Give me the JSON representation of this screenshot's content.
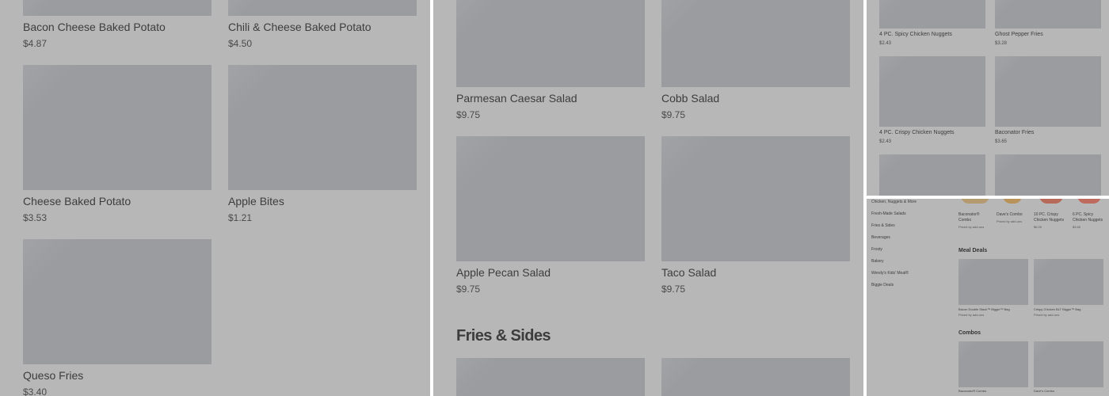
{
  "panel1": {
    "items": [
      {
        "name": "Bacon Cheese Baked Potato",
        "price": "$4.87"
      },
      {
        "name": "Chili & Cheese Baked Potato",
        "price": "$4.50"
      },
      {
        "name": "Cheese Baked Potato",
        "price": "$3.53"
      },
      {
        "name": "Apple Bites",
        "price": "$1.21"
      },
      {
        "name": "Queso Fries",
        "price": "$3.40"
      }
    ]
  },
  "panel2": {
    "items": [
      {
        "name": "Parmesan Caesar Salad",
        "price": "$9.75"
      },
      {
        "name": "Cobb Salad",
        "price": "$9.75"
      },
      {
        "name": "Apple Pecan Salad",
        "price": "$9.75"
      },
      {
        "name": "Taco Salad",
        "price": "$9.75"
      }
    ],
    "section_heading": "Fries & Sides"
  },
  "panel3": {
    "items": [
      {
        "name": "4 PC. Spicy Chicken Nuggets",
        "price": "$2.43"
      },
      {
        "name": "Ghost Pepper Fries",
        "price": "$3.28"
      },
      {
        "name": "4 PC. Crispy Chicken Nuggets",
        "price": "$2.43"
      },
      {
        "name": "Baconator Fries",
        "price": "$3.65"
      }
    ]
  },
  "panel4": {
    "sidebar": [
      "Chicken, Nuggets & More",
      "Fresh-Made Salads",
      "Fries & Sides",
      "Beverages",
      "Frosty",
      "Bakery",
      "Wendy's Kids' Meal®",
      "Biggie Deals"
    ],
    "top_items": [
      {
        "name": "Baconator® Combo",
        "sub": "Priced by add-ons"
      },
      {
        "name": "Dave's Combo",
        "sub": "Priced by add-ons"
      },
      {
        "name": "10 PC. Crispy Chicken Nuggets",
        "sub": "$6.09"
      },
      {
        "name": "6 PC. Spicy Chicken Nuggets",
        "sub": "$3.65"
      }
    ],
    "meal_deals_heading": "Meal Deals",
    "meal_deals": [
      {
        "name": "Bacon Double Stack™ Biggie™ Bag",
        "sub": "Priced by add-ons"
      },
      {
        "name": "Crispy Chicken BLT Biggie™ Bag",
        "sub": "Priced by add-ons"
      }
    ],
    "combos_heading": "Combos",
    "combos": [
      {
        "name": "Baconator® Combo"
      },
      {
        "name": "Dave's Combo"
      }
    ]
  },
  "colors": {
    "overlay_bg": "#b7b7b7",
    "placeholder": "#9a9c9f",
    "divider": "#ffffff"
  }
}
